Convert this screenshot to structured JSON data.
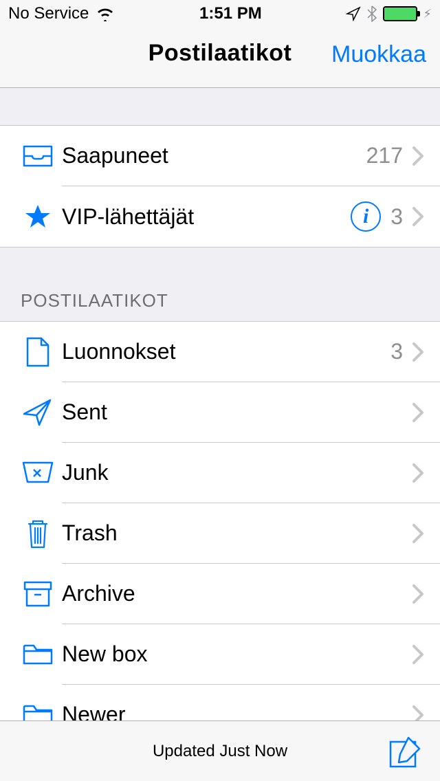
{
  "status": {
    "carrier": "No Service",
    "time": "1:51 PM"
  },
  "nav": {
    "title": "Postilaatikot",
    "edit": "Muokkaa"
  },
  "top_mailboxes": [
    {
      "icon": "inbox",
      "label": "Saapuneet",
      "count": "217",
      "info": false
    },
    {
      "icon": "star",
      "label": "VIP-lähettäjät",
      "count": "3",
      "info": true
    }
  ],
  "section_header": "POSTILAATIKOT",
  "account_mailboxes": [
    {
      "icon": "drafts",
      "label": "Luonnokset",
      "count": "3"
    },
    {
      "icon": "sent",
      "label": "Sent",
      "count": ""
    },
    {
      "icon": "junk",
      "label": "Junk",
      "count": ""
    },
    {
      "icon": "trash",
      "label": "Trash",
      "count": ""
    },
    {
      "icon": "archive",
      "label": "Archive",
      "count": ""
    },
    {
      "icon": "folder",
      "label": "New box",
      "count": ""
    },
    {
      "icon": "folder",
      "label": "Newer",
      "count": ""
    }
  ],
  "toolbar": {
    "status": "Updated Just Now"
  },
  "colors": {
    "tint": "#007aff"
  }
}
